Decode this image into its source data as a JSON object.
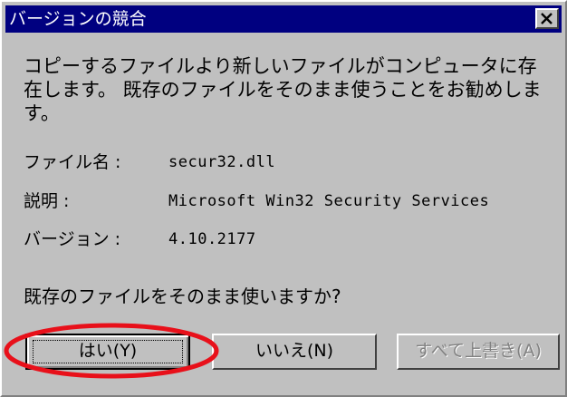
{
  "dialog": {
    "title": "バージョンの競合",
    "message": "コピーするファイルより新しいファイルがコンピュータに存在します。 既存のファイルをそのまま使うことをお勧めします。",
    "file_label": "ファイル名 :",
    "file_value": "secur32.dll",
    "desc_label": "説明 :",
    "desc_value": "Microsoft Win32 Security Services",
    "version_label": "バージョン :",
    "version_value": "4.10.2177",
    "question": "既存のファイルをそのまま使いますか?",
    "buttons": {
      "yes": "はい(Y)",
      "no": "いいえ(N)",
      "overwrite_all": "すべて上書き(A)"
    }
  },
  "colors": {
    "titlebar": "#000080",
    "face": "#c0c0c0",
    "highlight_ellipse": "#e8101a"
  },
  "icons": {
    "close": "close-icon"
  }
}
